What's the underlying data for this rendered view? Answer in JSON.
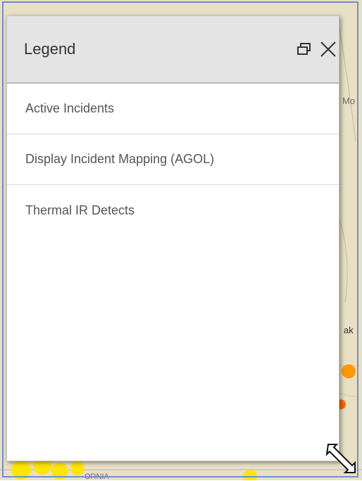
{
  "legend": {
    "title": "Legend",
    "items": [
      {
        "label": "Active Incidents"
      },
      {
        "label": "Display Incident Mapping (AGOL)"
      },
      {
        "label": "Thermal IR Detects"
      }
    ]
  },
  "map": {
    "partial_labels": [
      "Mo",
      "ak",
      "ORNIA"
    ]
  },
  "icons": {
    "restore": "restore-window-icon",
    "close": "close-icon",
    "resize": "resize-diagonal-icon"
  },
  "colors": {
    "header_bg": "#e4e4e4",
    "frame_border": "#6a8fd0",
    "incident_yellow": "#ffe600",
    "incident_orange": "#ff9900"
  }
}
